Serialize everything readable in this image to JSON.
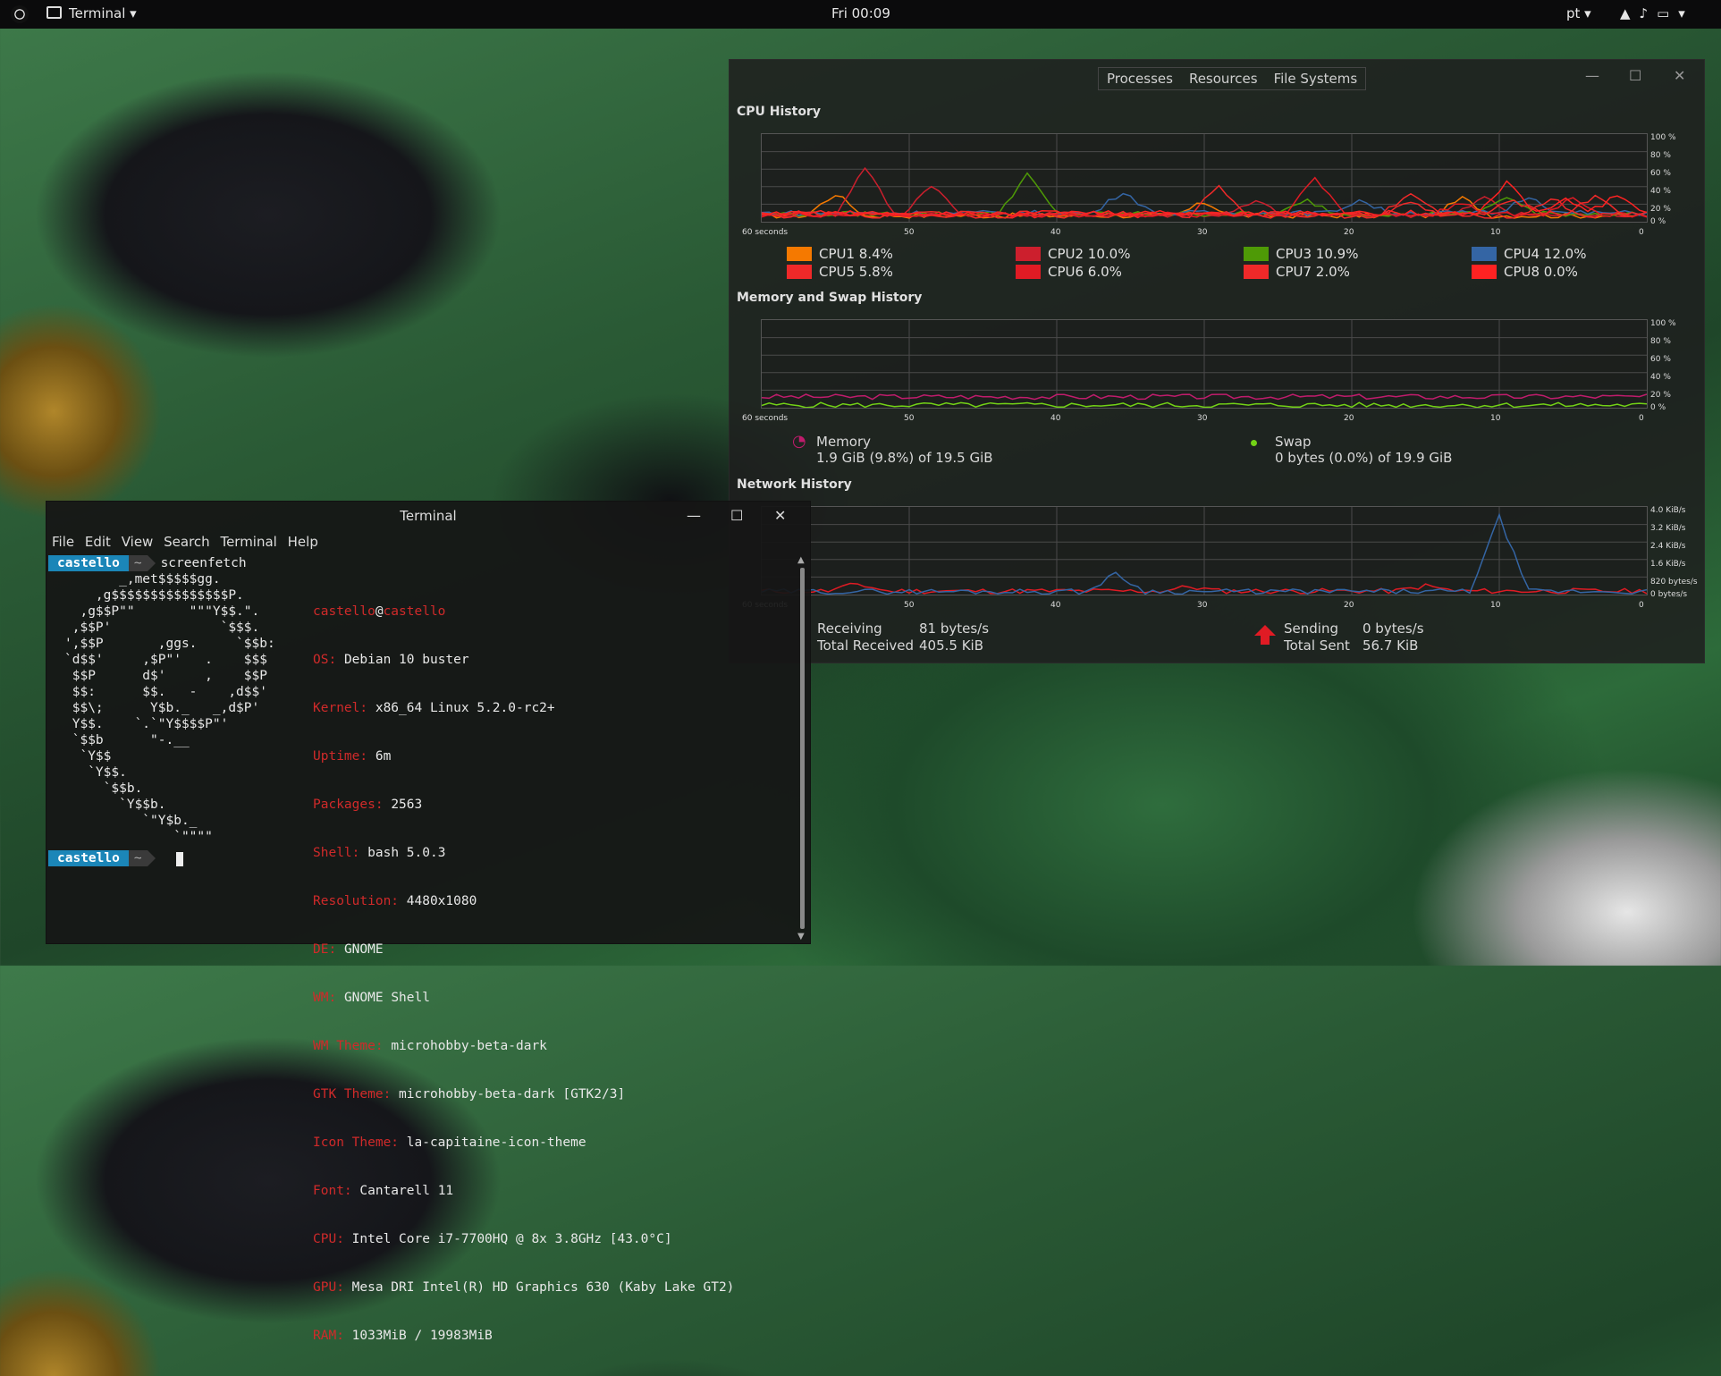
{
  "topbar": {
    "app_name": "Terminal ▾",
    "clock": "Fri 00:09",
    "lang": "pt ▾",
    "status_icons": "▲♪▭▾"
  },
  "monitor": {
    "tabs": [
      "Processes",
      "Resources",
      "File Systems"
    ],
    "sections": {
      "cpu": "CPU History",
      "memory": "Memory and Swap History",
      "network": "Network History"
    },
    "x_ticks": [
      "60 seconds",
      "50",
      "40",
      "30",
      "20",
      "10",
      "0"
    ],
    "pct_ticks": [
      "100 %",
      "80 %",
      "60 %",
      "40 %",
      "20 %",
      "0 %"
    ],
    "net_ticks": [
      "4.0 KiB/s",
      "3.2 KiB/s",
      "2.4 KiB/s",
      "1.6 KiB/s",
      "820 bytes/s",
      "0 bytes/s"
    ],
    "cpus": [
      {
        "label": "CPU1  8.4%",
        "color": "#f57900"
      },
      {
        "label": "CPU2  10.0%",
        "color": "#cc1f2d"
      },
      {
        "label": "CPU3  10.9%",
        "color": "#4e9a06"
      },
      {
        "label": "CPU4  12.0%",
        "color": "#3465a4"
      },
      {
        "label": "CPU5  5.8%",
        "color": "#ef2929"
      },
      {
        "label": "CPU6  6.0%",
        "color": "#e01b24"
      },
      {
        "label": "CPU7  2.0%",
        "color": "#ef2929"
      },
      {
        "label": "CPU8  0.0%",
        "color": "#f22"
      }
    ],
    "memory": {
      "label": "Memory",
      "value": "1.9 GiB (9.8%) of 19.5 GiB",
      "color": "#c01c6c"
    },
    "swap": {
      "label": "Swap",
      "value": "0 bytes (0.0%) of 19.9 GiB",
      "color": "#73d216"
    },
    "network": {
      "receiving_label": "Receiving",
      "receiving": "81 bytes/s",
      "total_received_label": "Total Received",
      "total_received": "405.5 KiB",
      "sending_label": "Sending",
      "sending": "0 bytes/s",
      "total_sent_label": "Total Sent",
      "total_sent": "56.7 KiB"
    }
  },
  "terminal": {
    "title": "Terminal",
    "menu": [
      "File",
      "Edit",
      "View",
      "Search",
      "Terminal",
      "Help"
    ],
    "prompt_user": "castello",
    "prompt_dir": "~",
    "command": "screenfetch",
    "header_user": "castello",
    "header_at": "@",
    "header_host": "castello",
    "info": [
      {
        "k": "OS:",
        "v": "Debian 10 buster"
      },
      {
        "k": "Kernel:",
        "v": "x86_64 Linux 5.2.0-rc2+"
      },
      {
        "k": "Uptime:",
        "v": "6m"
      },
      {
        "k": "Packages:",
        "v": "2563"
      },
      {
        "k": "Shell:",
        "v": "bash 5.0.3"
      },
      {
        "k": "Resolution:",
        "v": "4480x1080"
      },
      {
        "k": "DE:",
        "v": "GNOME"
      },
      {
        "k": "WM:",
        "v": "GNOME Shell"
      },
      {
        "k": "WM Theme:",
        "v": "microhobby-beta-dark"
      },
      {
        "k": "GTK Theme:",
        "v": "microhobby-beta-dark [GTK2/3]"
      },
      {
        "k": "Icon Theme:",
        "v": "la-capitaine-icon-theme"
      },
      {
        "k": "Font:",
        "v": "Cantarell 11"
      },
      {
        "k": "CPU:",
        "v": "Intel Core i7-7700HQ @ 8x 3.8GHz [43.0°C]"
      },
      {
        "k": "GPU:",
        "v": "Mesa DRI Intel(R) HD Graphics 630 (Kaby Lake GT2)"
      },
      {
        "k": "RAM:",
        "v": "1033MiB / 19983MiB"
      }
    ],
    "ascii_art": "       _,met$$$$$gg.\n    ,g$$$$$$$$$$$$$$$P.\n  ,g$$P\"\"       \"\"\"Y$$.\".\n ,$$P'              `$$$.\n',$$P       ,ggs.     `$$b:\n`d$$'     ,$P\"'   .    $$$\n $$P      d$'     ,    $$P\n $$:      $$.   -    ,d$$'\n $$\\;      Y$b._   _,d$P'\n Y$$.    `.`\"Y$$$$P\"'\n `$$b      \"-.__\n  `Y$$\n   `Y$$.\n     `$$b.\n       `Y$$b.\n          `\"Y$b._\n              `\"\"\"\""
  }
}
